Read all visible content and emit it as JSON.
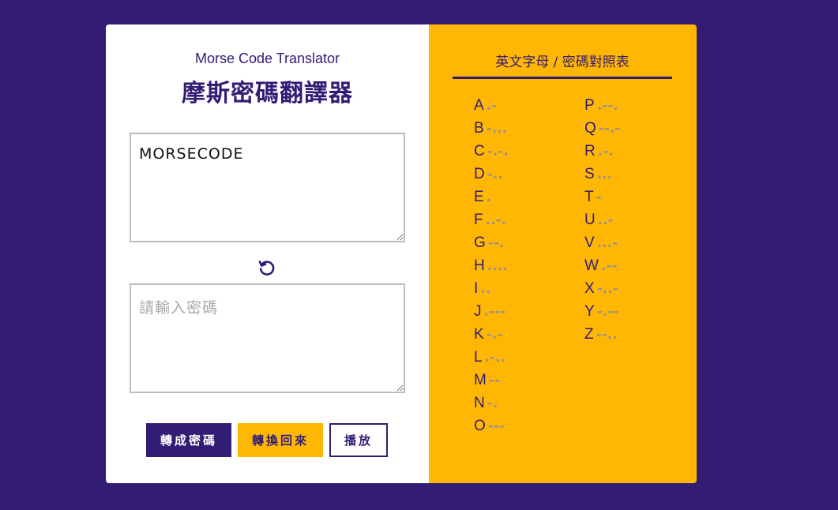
{
  "header": {
    "subtitle": "Morse Code Translator",
    "title": "摩斯密碼翻譯器"
  },
  "input": {
    "value": "MORSECODE",
    "placeholder": ""
  },
  "output": {
    "value": "",
    "placeholder": "請輸入密碼"
  },
  "swap_icon": "rotate-icon",
  "buttons": {
    "encode": "轉成密碼",
    "decode": "轉換回來",
    "play": "播放"
  },
  "reference": {
    "title": "英文字母 / 密碼對照表",
    "column1": [
      {
        "letter": "A",
        "code": ".-"
      },
      {
        "letter": "B",
        "code": "-..."
      },
      {
        "letter": "C",
        "code": "-.-."
      },
      {
        "letter": "D",
        "code": "-.."
      },
      {
        "letter": "E",
        "code": "."
      },
      {
        "letter": "F",
        "code": "..-."
      },
      {
        "letter": "G",
        "code": "--."
      },
      {
        "letter": "H",
        "code": "...."
      },
      {
        "letter": "I",
        "code": ".."
      },
      {
        "letter": "J",
        "code": ".---"
      },
      {
        "letter": "K",
        "code": "-.-"
      },
      {
        "letter": "L",
        "code": ".-.."
      },
      {
        "letter": "M",
        "code": "--"
      },
      {
        "letter": "N",
        "code": "-."
      },
      {
        "letter": "O",
        "code": "---"
      }
    ],
    "column2": [
      {
        "letter": "P",
        "code": ".--."
      },
      {
        "letter": "Q",
        "code": "--.-"
      },
      {
        "letter": "R",
        "code": ".-."
      },
      {
        "letter": "S",
        "code": "..."
      },
      {
        "letter": "T",
        "code": "-"
      },
      {
        "letter": "U",
        "code": "..-"
      },
      {
        "letter": "V",
        "code": "...-"
      },
      {
        "letter": "W",
        "code": ".--"
      },
      {
        "letter": "X",
        "code": "-..-"
      },
      {
        "letter": "Y",
        "code": "-.--"
      },
      {
        "letter": "Z",
        "code": "--.."
      }
    ]
  },
  "colors": {
    "background": "#331c73",
    "accent": "#ffb703",
    "code_text": "#9e9386"
  }
}
